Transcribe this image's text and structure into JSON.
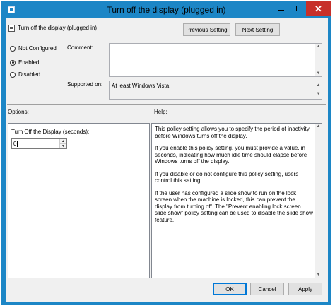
{
  "window": {
    "title": "Turn off the display (plugged in)",
    "close_glyph": "✕",
    "accent": "#1c86c6",
    "close_color": "#c7302a"
  },
  "header": {
    "policy_name": "Turn off the display (plugged in)",
    "previous_label": "Previous Setting",
    "next_label": "Next Setting"
  },
  "state": {
    "options": [
      {
        "label": "Not Configured",
        "selected": false
      },
      {
        "label": "Enabled",
        "selected": true
      },
      {
        "label": "Disabled",
        "selected": false
      }
    ]
  },
  "comment": {
    "label": "Comment:",
    "value": ""
  },
  "supported": {
    "label": "Supported on:",
    "value": "At least Windows Vista"
  },
  "sections": {
    "options_label": "Options:",
    "help_label": "Help:"
  },
  "options_panel": {
    "field_label": "Turn Off the Display (seconds):",
    "value": "0"
  },
  "help": {
    "paragraphs": [
      "This policy setting allows you to specify the period of inactivity before Windows turns off the display.",
      "If you enable this policy setting, you must provide a value, in seconds, indicating how much idle time should elapse before Windows turns off the display.",
      "If you disable or do not configure this policy setting, users control this setting.",
      "If the user has configured a slide show to run on the lock screen when the machine is locked, this can prevent the display from turning off. The \"Prevent enabling lock screen slide show\" policy setting can be used to disable the slide show feature."
    ]
  },
  "footer": {
    "ok_label": "OK",
    "cancel_label": "Cancel",
    "apply_label": "Apply"
  },
  "icons": {
    "up_arrow": "▲",
    "down_arrow": "▼"
  }
}
